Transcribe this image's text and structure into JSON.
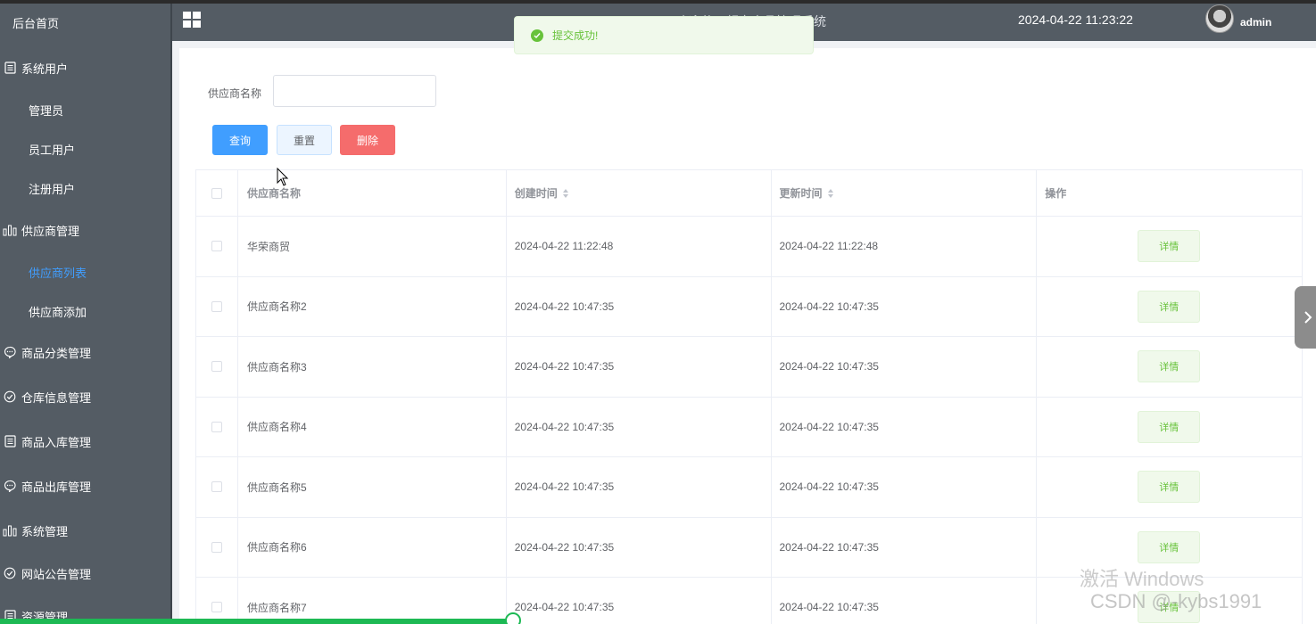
{
  "app": {
    "title": "欢迎使用超市商品管理系统",
    "datetime": "2024-04-22 11:23:22",
    "username": "admin"
  },
  "sidebar": {
    "home": "后台首页",
    "items": [
      {
        "label": "系统用户",
        "icon": "document-icon",
        "level": "top"
      },
      {
        "label": "管理员",
        "level": "sub"
      },
      {
        "label": "员工用户",
        "level": "sub"
      },
      {
        "label": "注册用户",
        "level": "sub"
      },
      {
        "label": "供应商管理",
        "icon": "bar-chart-icon",
        "level": "top"
      },
      {
        "label": "供应商列表",
        "level": "sub",
        "active": true
      },
      {
        "label": "供应商添加",
        "level": "sub"
      },
      {
        "label": "商品分类管理",
        "icon": "chat-bubble-icon",
        "level": "top"
      },
      {
        "label": "仓库信息管理",
        "icon": "check-circle-icon",
        "level": "top"
      },
      {
        "label": "商品入库管理",
        "icon": "document-icon",
        "level": "top"
      },
      {
        "label": "商品出库管理",
        "icon": "chat-bubble-icon",
        "level": "top"
      },
      {
        "label": "系统管理",
        "icon": "bar-chart-icon",
        "level": "top"
      },
      {
        "label": "网站公告管理",
        "icon": "check-circle-icon",
        "level": "top"
      },
      {
        "label": "资源管理",
        "icon": "document-icon",
        "level": "top"
      }
    ]
  },
  "toast": {
    "message": "提交成功!",
    "icon": "check-circle-icon"
  },
  "filter": {
    "label": "供应商名称",
    "value": "",
    "placeholder": ""
  },
  "buttons": {
    "query": "查询",
    "reset": "重置",
    "delete": "删除"
  },
  "table": {
    "columns": [
      "供应商名称",
      "创建时间",
      "更新时间",
      "操作"
    ],
    "detail_label": "详情",
    "rows": [
      {
        "name": "华荣商贸",
        "created": "2024-04-22 11:22:48",
        "updated": "2024-04-22 11:22:48"
      },
      {
        "name": "供应商名称2",
        "created": "2024-04-22 10:47:35",
        "updated": "2024-04-22 10:47:35"
      },
      {
        "name": "供应商名称3",
        "created": "2024-04-22 10:47:35",
        "updated": "2024-04-22 10:47:35"
      },
      {
        "name": "供应商名称4",
        "created": "2024-04-22 10:47:35",
        "updated": "2024-04-22 10:47:35"
      },
      {
        "name": "供应商名称5",
        "created": "2024-04-22 10:47:35",
        "updated": "2024-04-22 10:47:35"
      },
      {
        "name": "供应商名称6",
        "created": "2024-04-22 10:47:35",
        "updated": "2024-04-22 10:47:35"
      },
      {
        "name": "供应商名称7",
        "created": "2024-04-22 10:47:35",
        "updated": "2024-04-22 10:47:35"
      }
    ]
  },
  "watermarks": {
    "windows": "激活 Windows",
    "csdn": "CSDN @-kybs1991"
  },
  "video_progress": 0.39,
  "colors": {
    "sidebar_bg": "#545c64",
    "active": "#409eff",
    "primary": "#409eff",
    "danger": "#f56c6c",
    "success": "#67c23a"
  }
}
